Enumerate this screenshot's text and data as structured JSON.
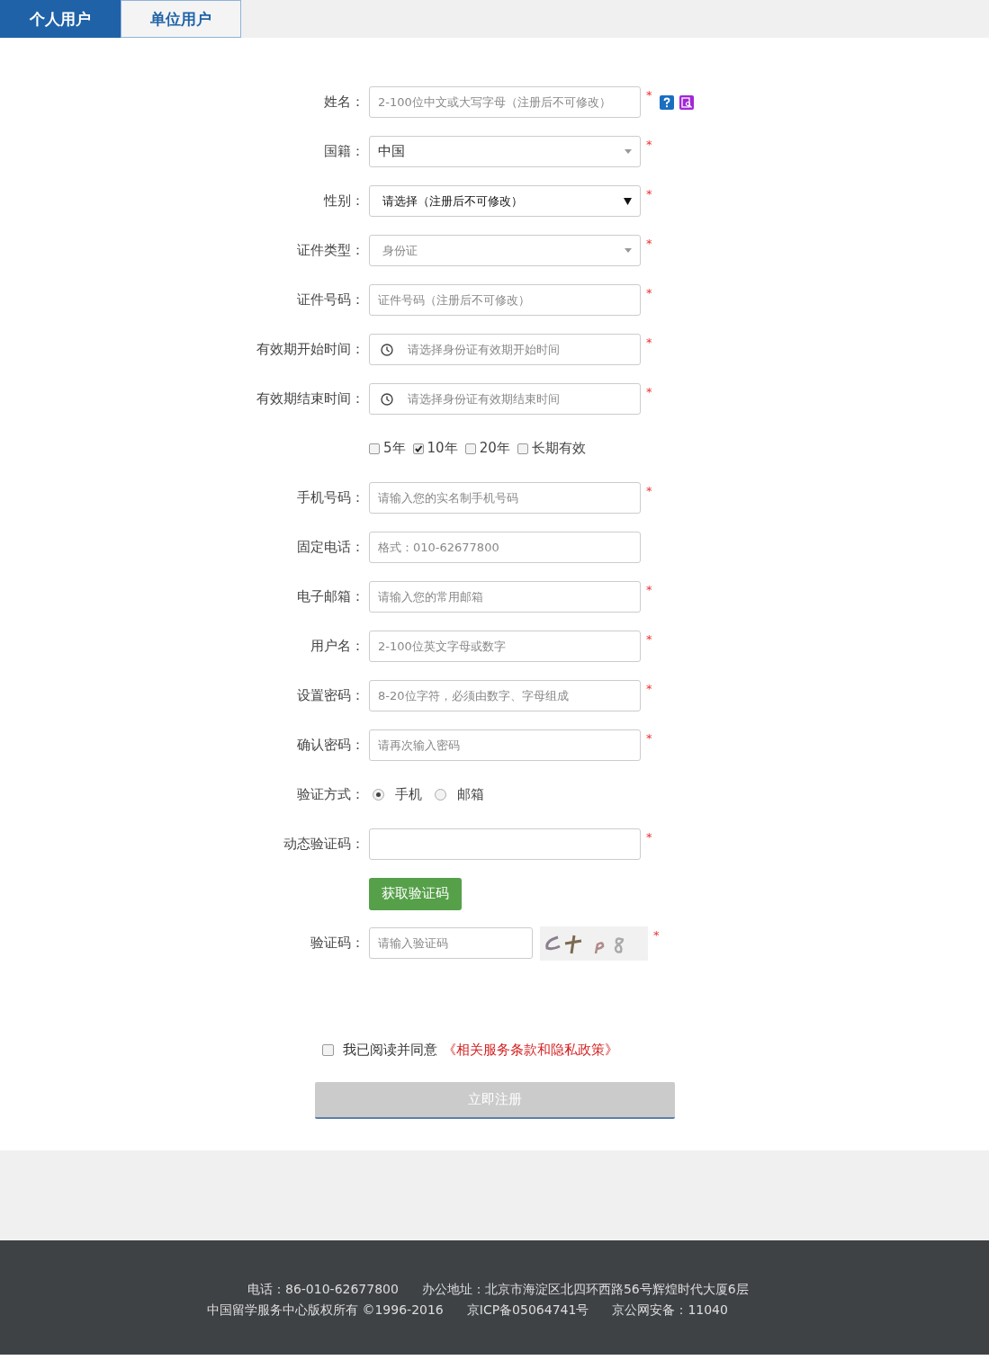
{
  "tabs": [
    {
      "label": "个人用户",
      "selected": true
    },
    {
      "label": "单位用户",
      "selected": false
    }
  ],
  "form": {
    "rows": [
      {
        "kind": "input",
        "label": "姓名：",
        "placeholder": "2-100位中文或大写字母（注册后不可修改）",
        "mark": "*",
        "help": true
      },
      {
        "kind": "select",
        "label": "国籍：",
        "value": "中国",
        "muted": false,
        "native": false,
        "mark": "*"
      },
      {
        "kind": "select",
        "label": "性别：",
        "value": "请选择（注册后不可修改）",
        "muted": false,
        "native": true,
        "mark": "*"
      },
      {
        "kind": "select",
        "label": "证件类型：",
        "value": "身份证",
        "muted": true,
        "native": false,
        "mark": "*"
      },
      {
        "kind": "input",
        "label": "证件号码：",
        "placeholder": "证件号码（注册后不可修改）",
        "mark": "*"
      },
      {
        "kind": "date",
        "label": "有效期开始时间：",
        "placeholder": "请选择身份证有效期开始时间",
        "mark": "*"
      },
      {
        "kind": "date",
        "label": "有效期结束时间：",
        "placeholder": "请选择身份证有效期结束时间",
        "mark": "*"
      },
      {
        "kind": "checkboxes",
        "options": [
          {
            "label": "5年",
            "checked": false
          },
          {
            "label": "10年",
            "checked": true
          },
          {
            "label": "20年",
            "checked": false
          },
          {
            "label": "长期有效",
            "checked": false
          }
        ]
      },
      {
        "kind": "input",
        "label": "手机号码：",
        "placeholder": "请输入您的实名制手机号码",
        "mark": "*"
      },
      {
        "kind": "input",
        "label": "固定电话：",
        "placeholder": "格式：010-62677800"
      },
      {
        "kind": "input",
        "label": "电子邮箱：",
        "placeholder": "请输入您的常用邮箱",
        "mark": "*"
      },
      {
        "kind": "input",
        "label": "用户名：",
        "placeholder": "2-100位英文字母或数字",
        "mark": "*"
      },
      {
        "kind": "input",
        "label": "设置密码：",
        "placeholder": "8-20位字符，必须由数字、字母组成",
        "mark": "*"
      },
      {
        "kind": "input",
        "label": "确认密码：",
        "placeholder": "请再次输入密码",
        "mark": "*"
      },
      {
        "kind": "radio",
        "label": "验证方式：",
        "options": [
          {
            "label": "手机",
            "selected": true
          },
          {
            "label": "邮箱",
            "selected": false
          }
        ]
      },
      {
        "kind": "input",
        "label": "动态验证码：",
        "mark": "*"
      },
      {
        "kind": "button",
        "label": "获取验证码"
      },
      {
        "kind": "captcha",
        "label": "验证码：",
        "placeholder": "请输入验证码",
        "mark": "*"
      }
    ],
    "agreement": {
      "checked": false,
      "text": "我已阅读并同意",
      "link": "《相关服务条款和隐私政策》"
    },
    "submit": {
      "label": "立即注册",
      "disabled": true
    }
  },
  "footer": {
    "lines": [
      [
        "电话：86-010-62677800",
        "办公地址：北京市海淀区北四环西路56号辉煌时代大厦6层"
      ],
      [
        "中国留学服务中心版权所有 ©1996-2016",
        "京ICP备05064741号",
        "京公网安备：11040"
      ]
    ]
  }
}
